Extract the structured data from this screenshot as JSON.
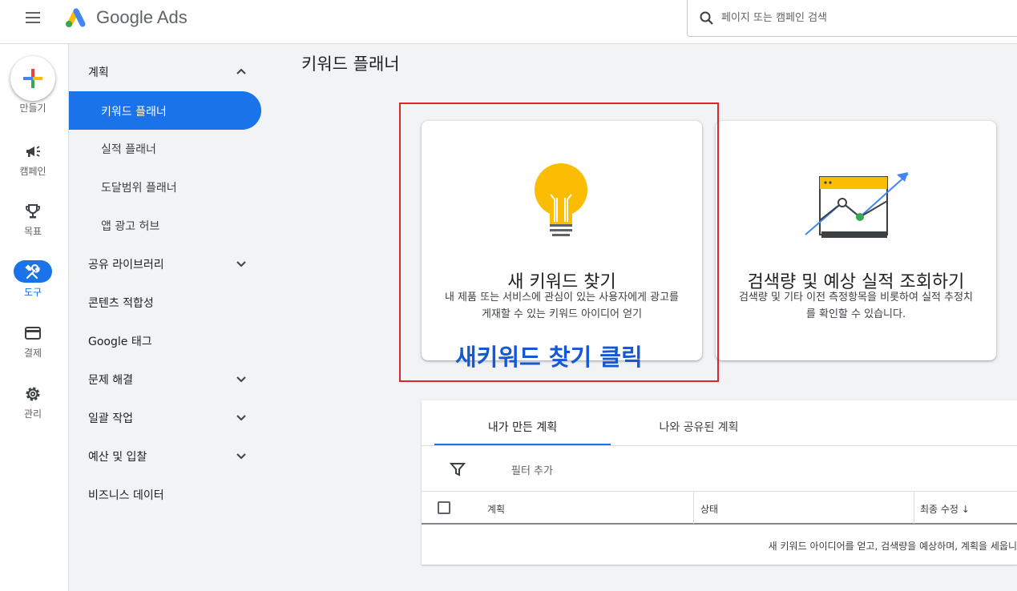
{
  "topbar": {
    "app_name": "Google Ads",
    "search_placeholder": "페이지 또는 캠페인 검색"
  },
  "rail": {
    "create_label": "만들기",
    "items": [
      {
        "label": "캠페인",
        "icon": "megaphone-icon"
      },
      {
        "label": "목표",
        "icon": "trophy-icon"
      },
      {
        "label": "도구",
        "icon": "tools-icon",
        "active": true
      },
      {
        "label": "결제",
        "icon": "credit-card-icon"
      },
      {
        "label": "관리",
        "icon": "gear-icon"
      }
    ]
  },
  "subnav": {
    "items": [
      {
        "label": "계획",
        "chevron": "up"
      },
      {
        "label": "키워드 플래너",
        "selected": true
      },
      {
        "label": "실적 플래너"
      },
      {
        "label": "도달범위 플래너"
      },
      {
        "label": "앱 광고 허브"
      },
      {
        "label": "공유 라이브러리",
        "chevron": "down"
      },
      {
        "label": "콘텐츠 적합성"
      },
      {
        "label": "Google 태그"
      },
      {
        "label": "문제 해결",
        "chevron": "down"
      },
      {
        "label": "일괄 작업",
        "chevron": "down"
      },
      {
        "label": "예산 및 입찰",
        "chevron": "down"
      },
      {
        "label": "비즈니스 데이터"
      }
    ]
  },
  "main": {
    "title": "키워드 플래너",
    "cards": [
      {
        "title": "새 키워드 찾기",
        "desc": "내 제품 또는 서비스에 관심이 있는 사용자에게 광고를 게재할 수 있는 키워드 아이디어 얻기",
        "icon": "lightbulb-icon"
      },
      {
        "title": "검색량 및 예상 실적 조회하기",
        "desc": "검색량 및 기타 이전 측정항목을 비롯하여 실적 추정치를 확인할 수 있습니다.",
        "icon": "chart-trend-icon"
      }
    ],
    "annotation": "새키워드 찾기 클릭"
  },
  "plans": {
    "tabs": [
      "내가 만든 계획",
      "나와 공유된 계획"
    ],
    "filter_label": "필터 추가",
    "columns": [
      "계획",
      "상태",
      "최종 수정 ↓"
    ],
    "empty_message": "새 키워드 아이디어를 얻고, 검색량을 예상하며, 계획을 세웁니"
  },
  "colors": {
    "accent": "#1a73e8",
    "annotation_box": "#e0242e",
    "annotation_text": "#1558d6"
  }
}
